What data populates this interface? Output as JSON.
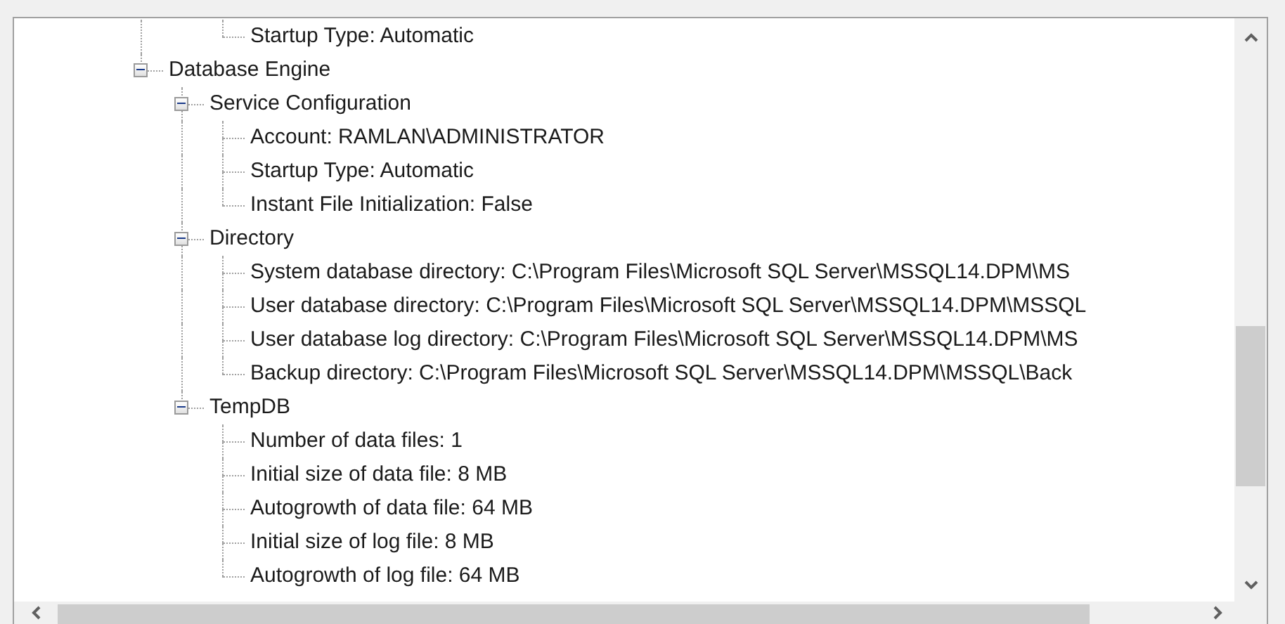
{
  "tree": {
    "nodes": [
      {
        "children": [
          {
            "children": [
              {
                "label": "Startup Type: Automatic"
              }
            ]
          }
        ]
      },
      {
        "label": "Database Engine",
        "expanded": true,
        "children": [
          {
            "label": "Service Configuration",
            "expanded": true,
            "children": [
              {
                "label": "Account: RAMLAN\\ADMINISTRATOR"
              },
              {
                "label": "Startup Type: Automatic"
              },
              {
                "label": "Instant File Initialization: False"
              }
            ]
          },
          {
            "label": "Directory",
            "expanded": true,
            "children": [
              {
                "label": "System database directory: C:\\Program Files\\Microsoft SQL Server\\MSSQL14.DPM\\MS"
              },
              {
                "label": "User database directory: C:\\Program Files\\Microsoft SQL Server\\MSSQL14.DPM\\MSSQL"
              },
              {
                "label": "User database log directory: C:\\Program Files\\Microsoft SQL Server\\MSSQL14.DPM\\MS"
              },
              {
                "label": "Backup directory: C:\\Program Files\\Microsoft SQL Server\\MSSQL14.DPM\\MSSQL\\Back"
              }
            ]
          },
          {
            "label": "TempDB",
            "expanded": true,
            "children": [
              {
                "label": "Number of data files: 1"
              },
              {
                "label": "Initial size of data file: 8 MB"
              },
              {
                "label": "Autogrowth of data file: 64 MB"
              },
              {
                "label": "Initial size of log file: 8 MB"
              },
              {
                "label": "Autogrowth of log file: 64 MB"
              }
            ]
          }
        ]
      }
    ]
  }
}
